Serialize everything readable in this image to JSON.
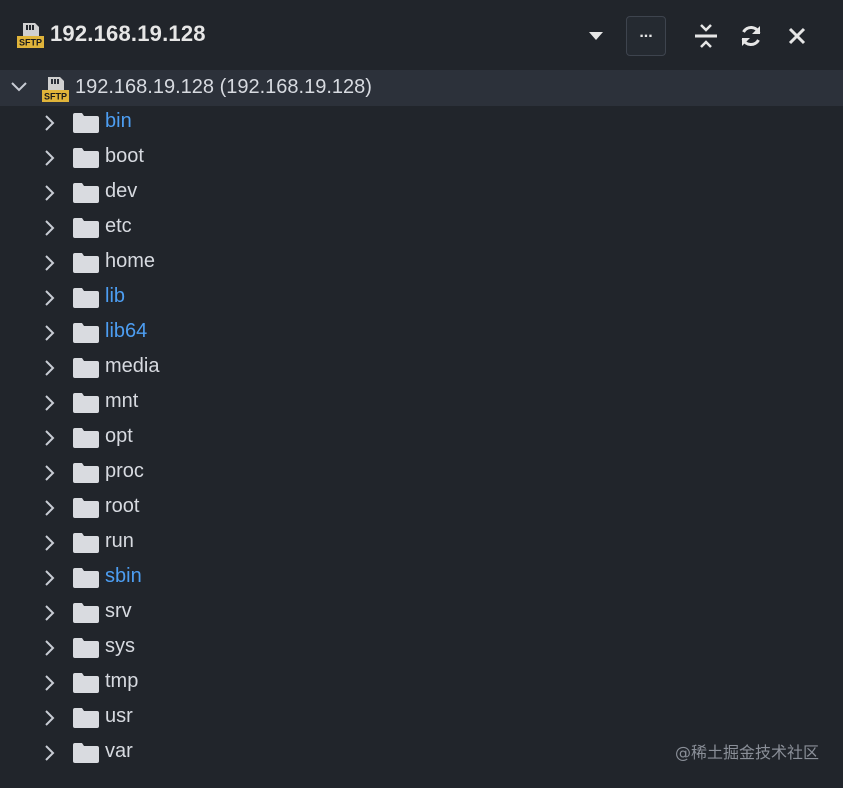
{
  "header": {
    "title": "192.168.19.128",
    "more_label": "..."
  },
  "root": {
    "label": "192.168.19.128 (192.168.19.128)",
    "icon": "sftp-icon",
    "expanded": true
  },
  "icons": {
    "sftp_badge_text": "SFTP"
  },
  "colors": {
    "background": "#21252b",
    "root_row_bg": "#2c313a",
    "text": "#d7dae0",
    "link": "#4d9ef2",
    "sftp_badge": "#e0b43a"
  },
  "items": [
    {
      "name": "bin",
      "link": true
    },
    {
      "name": "boot",
      "link": false
    },
    {
      "name": "dev",
      "link": false
    },
    {
      "name": "etc",
      "link": false
    },
    {
      "name": "home",
      "link": false
    },
    {
      "name": "lib",
      "link": true
    },
    {
      "name": "lib64",
      "link": true
    },
    {
      "name": "media",
      "link": false
    },
    {
      "name": "mnt",
      "link": false
    },
    {
      "name": "opt",
      "link": false
    },
    {
      "name": "proc",
      "link": false
    },
    {
      "name": "root",
      "link": false
    },
    {
      "name": "run",
      "link": false
    },
    {
      "name": "sbin",
      "link": true
    },
    {
      "name": "srv",
      "link": false
    },
    {
      "name": "sys",
      "link": false
    },
    {
      "name": "tmp",
      "link": false
    },
    {
      "name": "usr",
      "link": false
    },
    {
      "name": "var",
      "link": false
    }
  ],
  "watermark": "@稀土掘金技术社区"
}
